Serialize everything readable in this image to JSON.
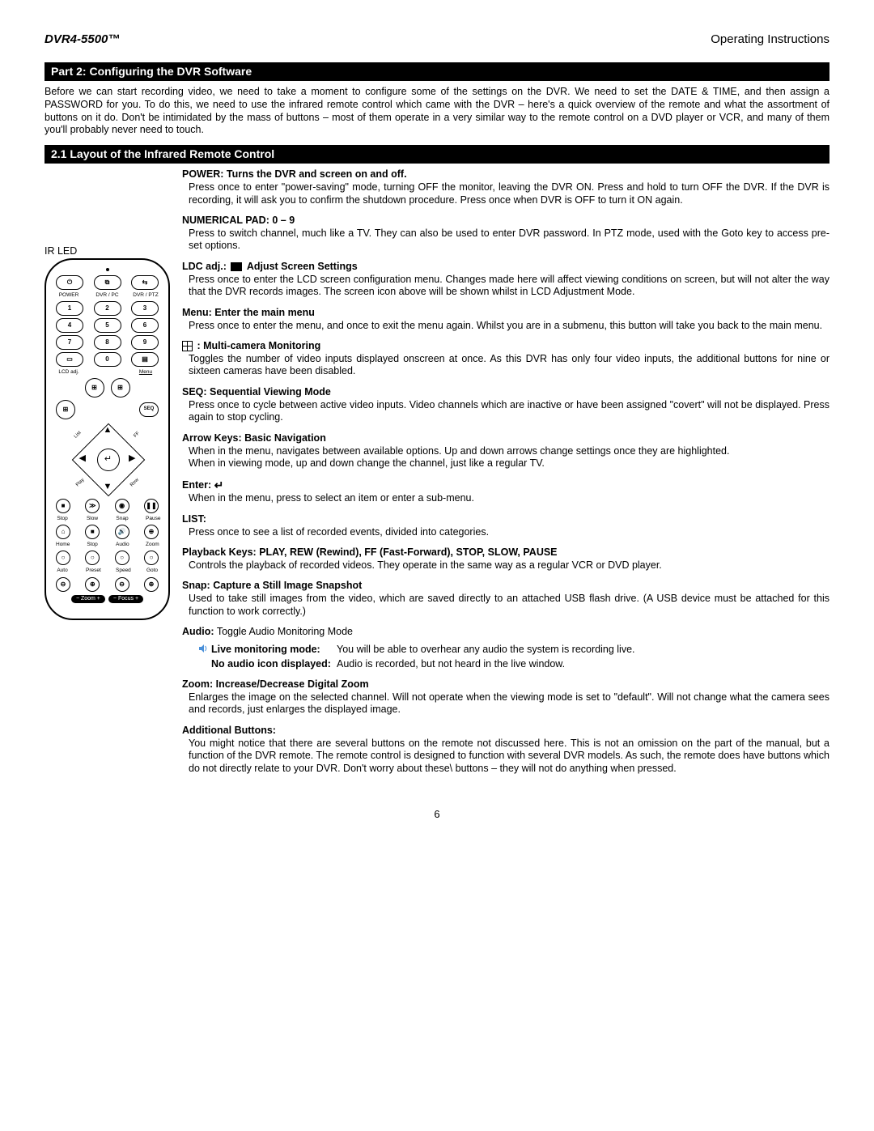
{
  "header": {
    "model": "DVR4-5500™",
    "right": "Operating Instructions"
  },
  "section1": "Part 2: Configuring the DVR Software",
  "intro": "Before we can start recording video, we need to take a moment to configure some of the settings on the DVR. We need to set the DATE & TIME, and then assign a PASSWORD for you. To do this, we need to use the infrared remote control which came with the DVR – here's a quick overview of the remote and what the assortment of buttons on it do. Don't be intimidated by the mass of buttons – most of them operate in a very similar way to the remote control on a DVD player or VCR, and many of them you'll probably never need to touch.",
  "section2": "2.1 Layout of the Infrared Remote Control",
  "remote": {
    "irled": "IR LED",
    "row1_labels": [
      "POWER",
      "DVR / PC",
      "DVR / PTZ"
    ],
    "numpad": [
      [
        "1",
        "2",
        "3"
      ],
      [
        "4",
        "5",
        "6"
      ],
      [
        "7",
        "8",
        "9"
      ]
    ],
    "zero": "0",
    "lcd": "LCD adj.",
    "menu": "Menu",
    "seq": "SEQ",
    "play_labels": [
      "Stop",
      "Slow",
      "Snap",
      "Pause"
    ],
    "home_labels": [
      "Home",
      "Stop",
      "Audio",
      "Zoom"
    ],
    "auto_labels": [
      "Auto",
      "Preset",
      "Speed",
      "Goto"
    ],
    "zoom_pill": "−  Zoom  +",
    "focus_pill": "−  Focus  +",
    "dpad_corners": [
      "List",
      "FF",
      "Play",
      "Rew"
    ]
  },
  "items": {
    "power": {
      "title": "POWER: Turns the DVR and screen on and off.",
      "body": "Press once to enter \"power-saving\" mode, turning OFF the monitor, leaving the DVR ON. Press and hold to turn OFF the DVR.  If the DVR is recording, it will ask you to confirm the shutdown procedure.  Press once when DVR is OFF to turn it ON again."
    },
    "numpad": {
      "title": "NUMERICAL PAD: 0 – 9",
      "body": "Press to switch channel, much like a TV. They can also be used to enter DVR password. In PTZ mode, used with the Goto key to access pre-set options."
    },
    "ldc": {
      "title_before": "LDC adj.:",
      "title_after": " Adjust Screen Settings",
      "body": "Press once to enter the LCD screen configuration menu. Changes made here will affect viewing conditions on screen, but will not alter the way that the DVR records images. The screen icon above will be shown whilst in LCD Adjustment Mode."
    },
    "menu": {
      "title": "Menu: Enter the main menu",
      "body": "Press once to enter the menu, and once to exit the menu again. Whilst you are in a submenu, this button will take you back to the main menu."
    },
    "multi": {
      "title": ": Multi-camera Monitoring",
      "body": "Toggles the number of video inputs displayed onscreen at once. As this DVR has only four video inputs, the additional buttons for nine or sixteen cameras have been disabled."
    },
    "seq": {
      "title": "SEQ: Sequential Viewing Mode",
      "body": "Press once to cycle between active video inputs. Video channels which are inactive or have been assigned \"covert\" will not be displayed. Press again to stop cycling."
    },
    "arrows": {
      "title": "Arrow Keys: Basic Navigation",
      "body1": "When in the menu, navigates between available options. Up and down arrows change settings once they are highlighted.",
      "body2": "When in viewing mode, up and down change the channel, just like a regular TV."
    },
    "enter": {
      "title": "Enter: ",
      "body": "When in the menu, press to select an item or enter a sub-menu."
    },
    "list": {
      "title": "LIST:",
      "body": "Press once to see a list of recorded events, divided into categories."
    },
    "playback": {
      "title": "Playback Keys: PLAY, REW (Rewind), FF (Fast-Forward), STOP, SLOW, PAUSE",
      "body": "Controls the playback of recorded videos. They operate in the same way as a regular VCR or DVD player."
    },
    "snap": {
      "title": "Snap: Capture a Still Image Snapshot",
      "body": "Used to take still images from the video, which are saved directly to an attached USB flash drive. (A USB device must be attached for this function to work correctly.)"
    },
    "audio": {
      "title_bold": "Audio:",
      "title_rest": " Toggle Audio Monitoring Mode",
      "live_label": "Live monitoring mode:",
      "live_text": "You will be able to overhear any audio the system is recording live.",
      "no_label": "No audio icon displayed:",
      "no_text": "Audio is recorded, but not heard in the live window."
    },
    "zoom": {
      "title": "Zoom: Increase/Decrease Digital Zoom",
      "body": "Enlarges the image on the selected channel. Will not operate when the viewing mode is set to \"default\". Will not change what the camera sees and records, just enlarges the displayed image."
    },
    "additional": {
      "title": "Additional Buttons:",
      "body": "You might notice that there are several buttons on the remote not discussed here. This is not an omission on the part of the manual, but a function of the DVR remote. The remote control is designed to function with several DVR models. As such, the remote does have buttons which do not directly relate to your DVR. Don't worry about these\\ buttons – they will not do anything when pressed."
    }
  },
  "page_no": "6"
}
